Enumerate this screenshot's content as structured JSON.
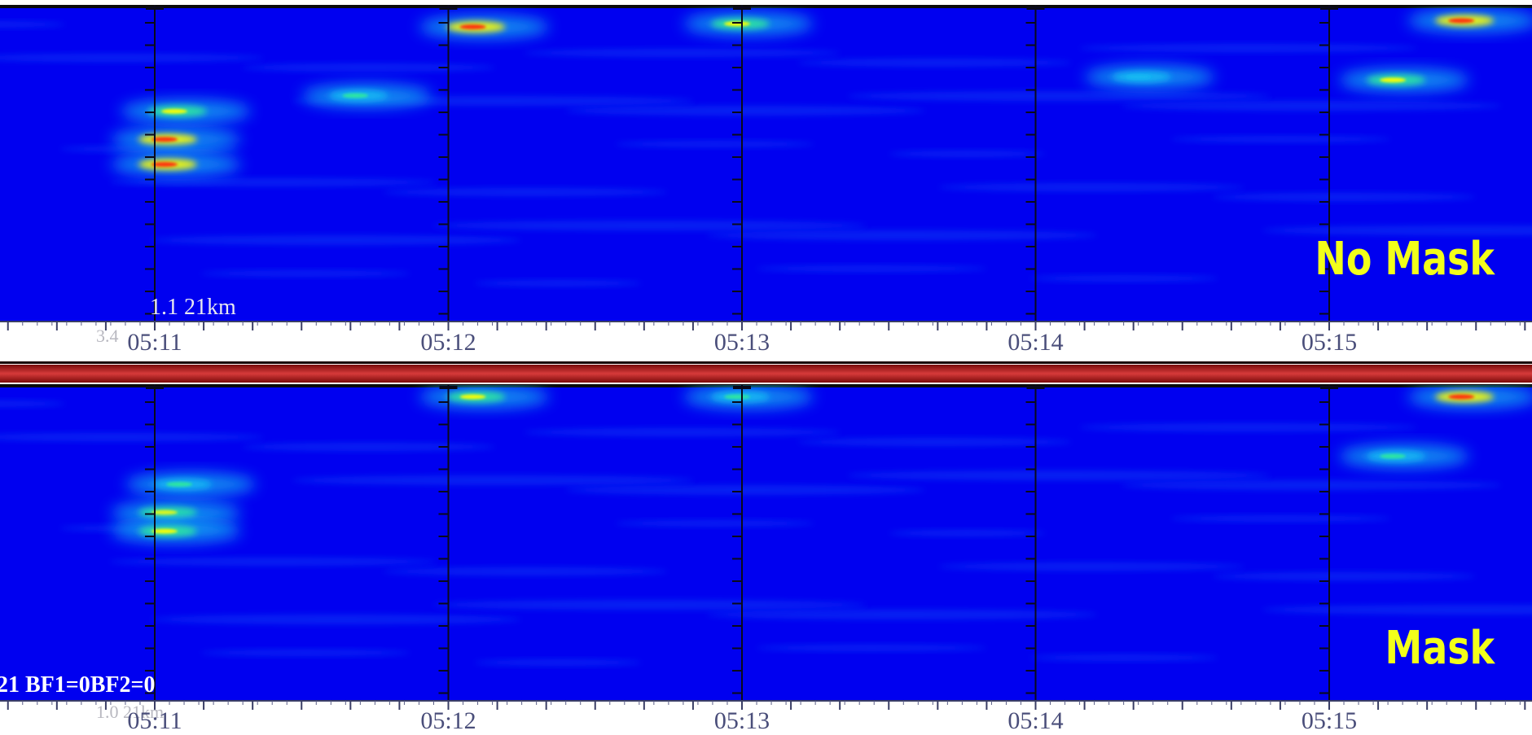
{
  "chart_data": [
    {
      "type": "heatmap",
      "panel_label": "No Mask",
      "overlay_text": "1.1  21km",
      "faint_text": "3.4",
      "x_tick_labels": [
        "05:11",
        "05:12",
        "05:13",
        "05:14",
        "05:15"
      ],
      "colormap": [
        "#0000f0",
        "#0b3df5",
        "#12b8f2",
        "#2ee8a0",
        "#ffff00",
        "#ff2a10"
      ],
      "hotspots": [
        {
          "time": "05:11:01",
          "band": 0.42,
          "level": 0.95
        },
        {
          "time": "05:11:01",
          "band": 0.5,
          "level": 0.9
        },
        {
          "time": "05:11:03",
          "band": 0.33,
          "level": 0.7
        },
        {
          "time": "05:11:40",
          "band": 0.28,
          "level": 0.55
        },
        {
          "time": "05:12:04",
          "band": 0.06,
          "level": 1.0
        },
        {
          "time": "05:12:58",
          "band": 0.05,
          "level": 0.85
        },
        {
          "time": "05:14:20",
          "band": 0.22,
          "level": 0.45
        },
        {
          "time": "05:15:12",
          "band": 0.23,
          "level": 0.8
        },
        {
          "time": "05:15:26",
          "band": 0.04,
          "level": 1.0
        },
        {
          "time": "05:10:05",
          "band": 0.06,
          "level": 0.55
        }
      ]
    },
    {
      "type": "heatmap",
      "panel_label": "Mask",
      "overlay_text": "21 BF1=0BF2=0",
      "faint_text": "1.0  21km",
      "x_tick_labels": [
        "05:11",
        "05:12",
        "05:13",
        "05:14",
        "05:15"
      ],
      "colormap": [
        "#0000f0",
        "#0b3df5",
        "#12b8f2",
        "#2ee8a0",
        "#ffff00",
        "#ff2a10"
      ],
      "hotspots": [
        {
          "time": "05:11:01",
          "band": 0.4,
          "level": 0.85
        },
        {
          "time": "05:11:01",
          "band": 0.46,
          "level": 0.8
        },
        {
          "time": "05:11:04",
          "band": 0.31,
          "level": 0.55
        },
        {
          "time": "05:12:04",
          "band": 0.03,
          "level": 0.75
        },
        {
          "time": "05:12:58",
          "band": 0.03,
          "level": 0.6
        },
        {
          "time": "05:15:12",
          "band": 0.22,
          "level": 0.55
        },
        {
          "time": "05:15:26",
          "band": 0.03,
          "level": 0.95
        },
        {
          "time": "05:10:05",
          "band": 0.06,
          "level": 0.5
        }
      ]
    }
  ]
}
